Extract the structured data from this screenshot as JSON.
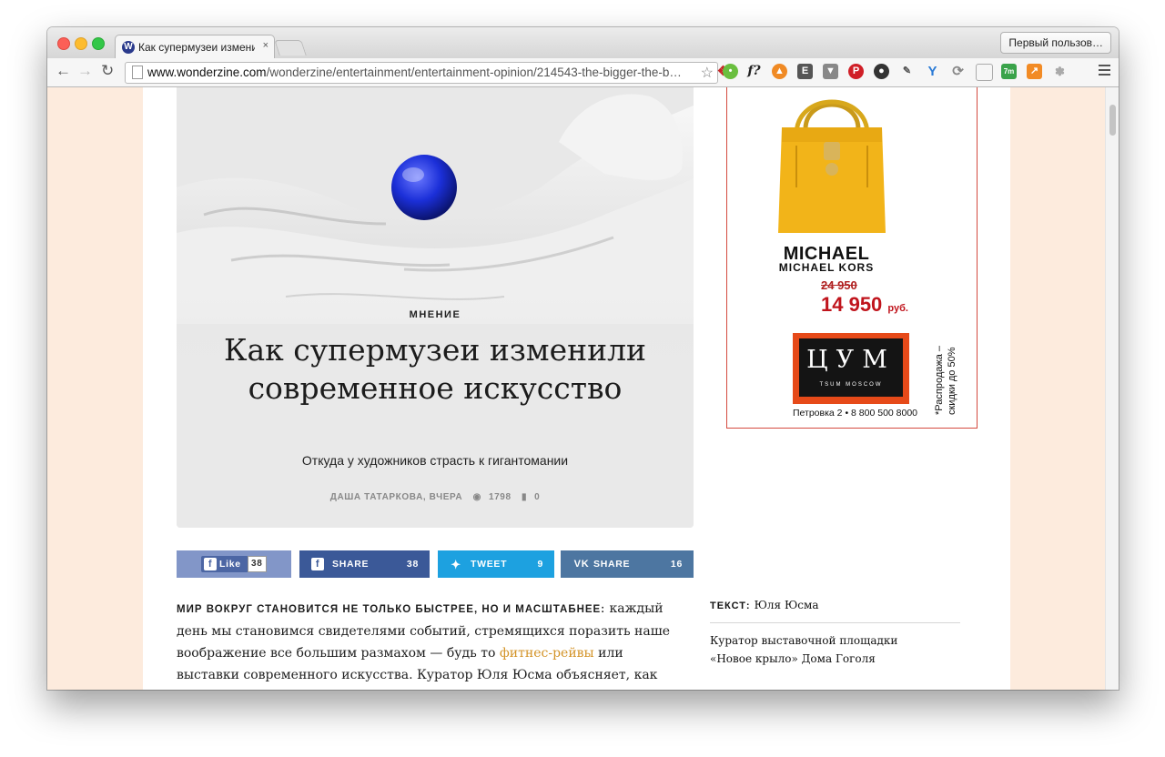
{
  "browser": {
    "tab_title": "Как супермузеи изменили",
    "tab_favicon": "W",
    "tab_close": "×",
    "profile_button": "Первый пользов…",
    "url_domain": "www.wonderzine.com",
    "url_path": "/wonderzine/entertainment/entertainment-opinion/214543-the-bigger-the-b…",
    "extensions": [
      "red-dragon-icon",
      "green-circle-icon",
      "f-icon",
      "flame-icon",
      "evernote-icon",
      "pocket-icon",
      "pinterest-icon",
      "camera-icon",
      "eyedropper-icon",
      "y-icon",
      "refresh-circle-icon",
      "reader-icon",
      "7m-icon",
      "chart-icon",
      "paw-icon"
    ],
    "ext_labels": {
      "f": "f?",
      "seven": "7m"
    }
  },
  "hero": {
    "kicker": "МНЕНИЕ",
    "headline": "Как супермузеи изменили современное искусство",
    "subtitle": "Откуда у художников страсть к гигантомании",
    "author_date": "ДАША ТАТАРКОВА, ВЧЕРА",
    "views": "1798",
    "comments": "0"
  },
  "share": {
    "like": {
      "label": "Like",
      "count": "38"
    },
    "facebook": {
      "label": "SHARE",
      "count": "38"
    },
    "twitter": {
      "label": "TWEET",
      "count": "9"
    },
    "vk": {
      "label": "SHARE",
      "count": "16"
    }
  },
  "article": {
    "lead": "МИР ВОКРУГ СТАНОВИТСЯ НЕ ТОЛЬКО БЫСТРЕЕ, НО И МАСШТАБНЕЕ:",
    "text1": " каждый день мы становимся свидетелями событий, стремящихся поразить наше воображение все большим размахом — будь то ",
    "link": "фитнес-рейвы",
    "text2": " или выставки современного искусства. Куратор Юля Юсма объясняет, как художники адаптировались к"
  },
  "ad": {
    "brand": "MICHAEL",
    "brand_sub": "MICHAEL KORS",
    "old_price": "24 950",
    "new_price": "14 950",
    "currency": "руб.",
    "tsum_logo": "ЦУМ",
    "tsum_sub": "TSUM MOSCOW",
    "address": "Петровка 2 • 8 800 500 8000",
    "sale": "*Распродажа – скидки до 50%"
  },
  "sidebar": {
    "author_label": "ТЕКСТ:",
    "author_name": "Юля Юсма",
    "author_desc_1": "Куратор выставочной площадки",
    "author_desc_2": "«Новое крыло» Дома Гоголя"
  },
  "colors": {
    "page_bg": "#fdebdd",
    "like": "#8296c8",
    "facebook": "#3b5998",
    "twitter": "#1da1e0",
    "vk": "#4d76a1",
    "link": "#d39327",
    "price": "#c0141c"
  }
}
